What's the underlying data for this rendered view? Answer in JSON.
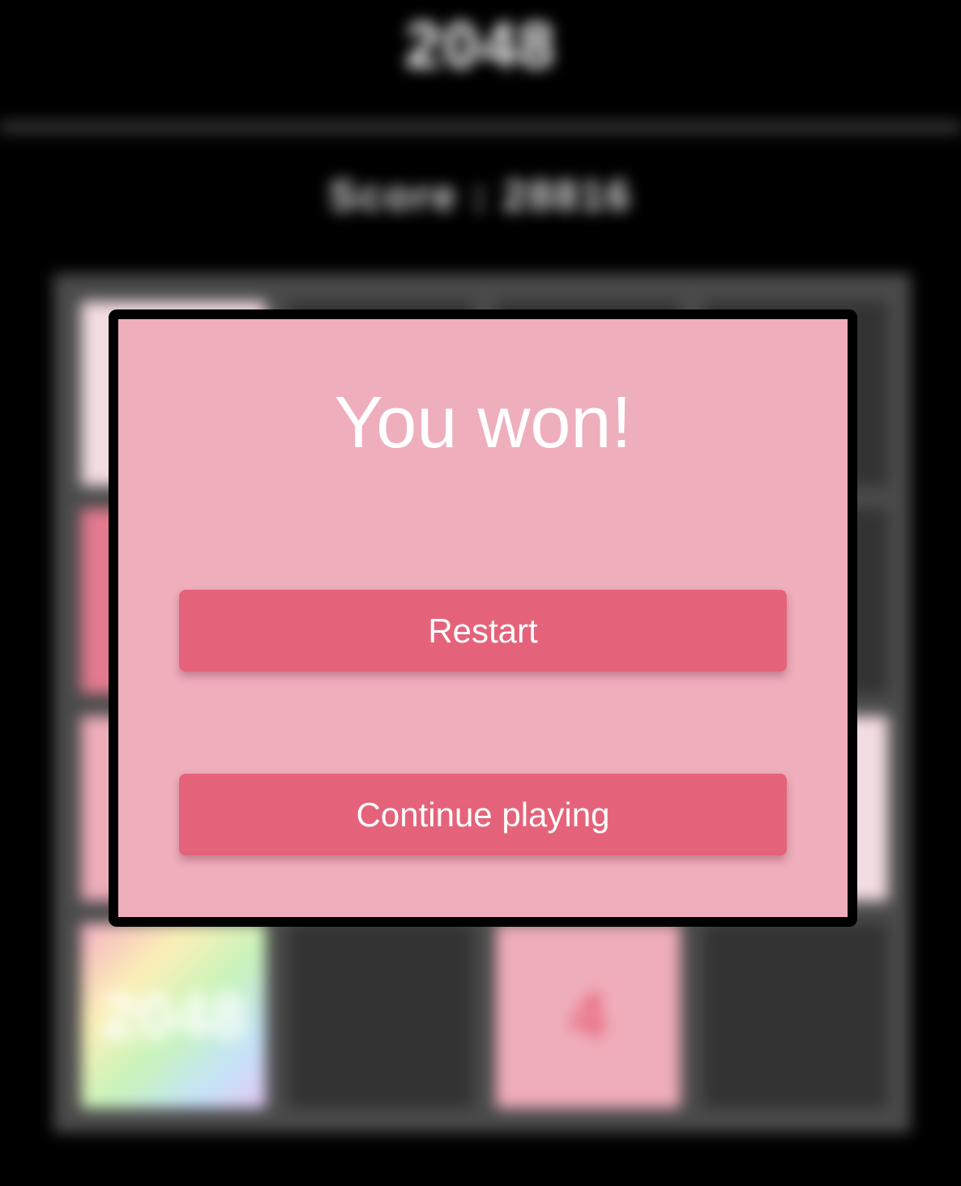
{
  "game": {
    "title": "2048",
    "score_text": "Score : 28816",
    "board": [
      [
        "",
        "",
        "",
        ""
      ],
      [
        "",
        "",
        "",
        ""
      ],
      [
        "",
        "",
        "",
        ""
      ],
      [
        "2048",
        "",
        "4",
        ""
      ]
    ],
    "board_styles": [
      [
        "v-light",
        "",
        "",
        ""
      ],
      [
        "v-rose",
        "",
        "",
        ""
      ],
      [
        "v-pink",
        "",
        "",
        "v-light"
      ],
      [
        "v-rainbow",
        "",
        "v-pink",
        ""
      ]
    ]
  },
  "modal": {
    "title": "You won!",
    "restart_label": "Restart",
    "continue_label": "Continue playing"
  },
  "colors": {
    "modal_bg": "#efaebc",
    "button_bg": "#e5637a",
    "tile_empty": "#333333",
    "board_bg": "#4a4a4a"
  }
}
